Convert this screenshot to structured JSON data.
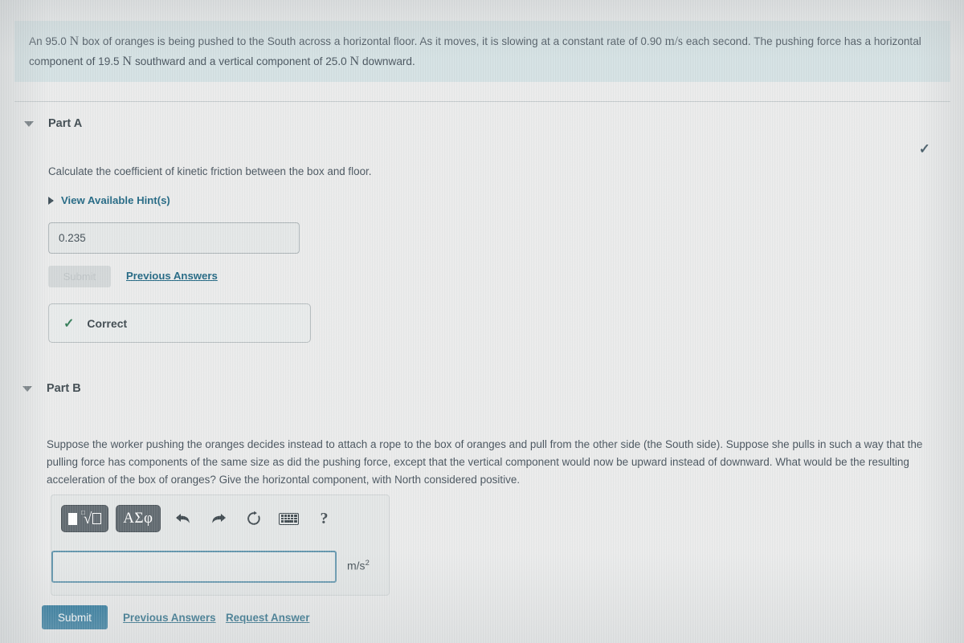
{
  "problem": {
    "text_before_force1": "An 95.0",
    "unit_newton": "N",
    "text_mid1": "box of oranges is being pushed to the South across a horizontal floor. As it moves, it is slowing at a constant rate of 0.90",
    "unit_speed": "m/s",
    "text_mid2": "each second. The pushing force has a horizontal component of 19.5",
    "unit_newton2": "N",
    "text_mid3": "southward and a vertical component of 25.0",
    "unit_newton3": "N",
    "text_end": "downward."
  },
  "part_a": {
    "title": "Part A",
    "status_check_icon": "check-icon",
    "prompt": "Calculate the coefficient of kinetic friction between the box and floor.",
    "hints_label": "View Available Hint(s)",
    "answer_value": "0.235",
    "answer_placeholder": "",
    "submit_label": "Submit",
    "submit_disabled": true,
    "previous_answers_label": "Previous Answers",
    "feedback_icon": "check-icon",
    "feedback_label": "Correct"
  },
  "part_b": {
    "title": "Part B",
    "prompt": "Suppose the worker pushing the oranges decides instead to attach a rope to the box of oranges and pull from the other side (the South side). Suppose she pulls in such a way that the pulling force has components of the same size as did the pushing force, except that the vertical component would now be upward instead of downward. What would be the resulting acceleration of the box of oranges? Give the horizontal component, with North considered positive.",
    "toolbar": {
      "template_button_label": "math-template",
      "greek_button_label": "ΑΣφ",
      "undo_label": "undo-arrow-icon",
      "redo_label": "redo-arrow-icon",
      "reset_label": "reset-circle-icon",
      "keyboard_label": "keyboard-icon",
      "help_label": "?"
    },
    "answer_value": "",
    "answer_placeholder": "",
    "units": "m/s",
    "units_exponent": "2",
    "submit_label": "Submit",
    "previous_answers_label": "Previous Answers",
    "request_answer_label": "Request Answer"
  },
  "colors": {
    "banner_bg": "#d3e0e2",
    "link": "#1d6480",
    "submit_primary": "#1f6f95",
    "correct_green": "#2f7a54",
    "input_focus_border": "#5f93ab",
    "page_bg": "#e9eaea"
  }
}
